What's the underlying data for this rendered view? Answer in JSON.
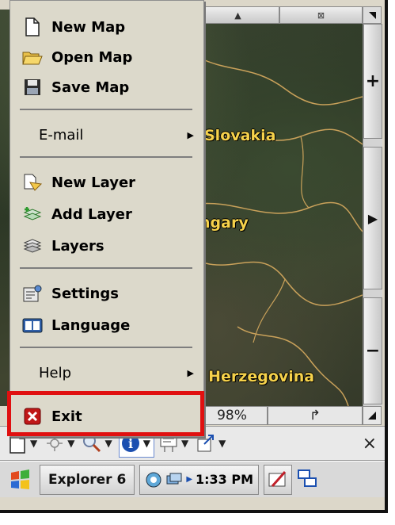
{
  "menu": {
    "items": [
      {
        "label": "New Map",
        "icon": "new-map-icon"
      },
      {
        "label": "Open Map",
        "icon": "open-folder-icon"
      },
      {
        "label": "Save Map",
        "icon": "save-disk-icon"
      },
      {
        "label": "E-mail",
        "icon": "",
        "submenu": true
      },
      {
        "label": "New Layer",
        "icon": "new-layer-icon"
      },
      {
        "label": "Add Layer",
        "icon": "add-layer-icon"
      },
      {
        "label": "Layers",
        "icon": "layers-icon"
      },
      {
        "label": "Settings",
        "icon": "settings-icon"
      },
      {
        "label": "Language",
        "icon": "language-icon"
      },
      {
        "label": "Help",
        "icon": "",
        "submenu": true
      },
      {
        "label": "Exit",
        "icon": "exit-icon"
      }
    ]
  },
  "map": {
    "labels": [
      "Slovakia",
      "ngary",
      "l Herzegovina"
    ],
    "zoom": "98%"
  },
  "scrollbar": {
    "top_mid_glyph": "⊠",
    "zoom_in": "+",
    "zoom_out": "−",
    "pan_right": "▶"
  },
  "statusbar": {
    "zoom_text": "98%",
    "arrow": "↱"
  },
  "toolbar": {
    "close": "×"
  },
  "taskbar": {
    "app": "Explorer 6",
    "time": "1:33 PM"
  },
  "colors": {
    "highlight": "#e01010",
    "map_label": "#f6d24b",
    "border_lines": "#c9a15a"
  }
}
